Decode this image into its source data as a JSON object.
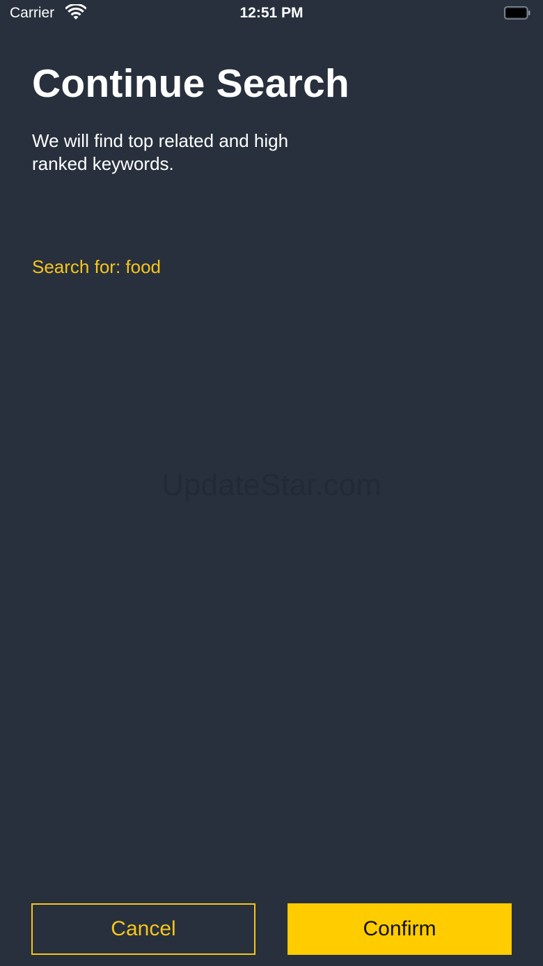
{
  "status_bar": {
    "carrier": "Carrier",
    "time": "12:51 PM",
    "icons": [
      "wifi-icon",
      "battery-icon"
    ]
  },
  "header": {
    "title": "Continue Search",
    "subtitle": "We will find top related and high ranked keywords."
  },
  "search": {
    "label": "Search for: food"
  },
  "watermark": "UpdateStar.com",
  "actions": {
    "cancel_label": "Cancel",
    "confirm_label": "Confirm"
  },
  "colors": {
    "background": "#27303c",
    "accent": "#ffcc00",
    "text": "#ffffff"
  }
}
